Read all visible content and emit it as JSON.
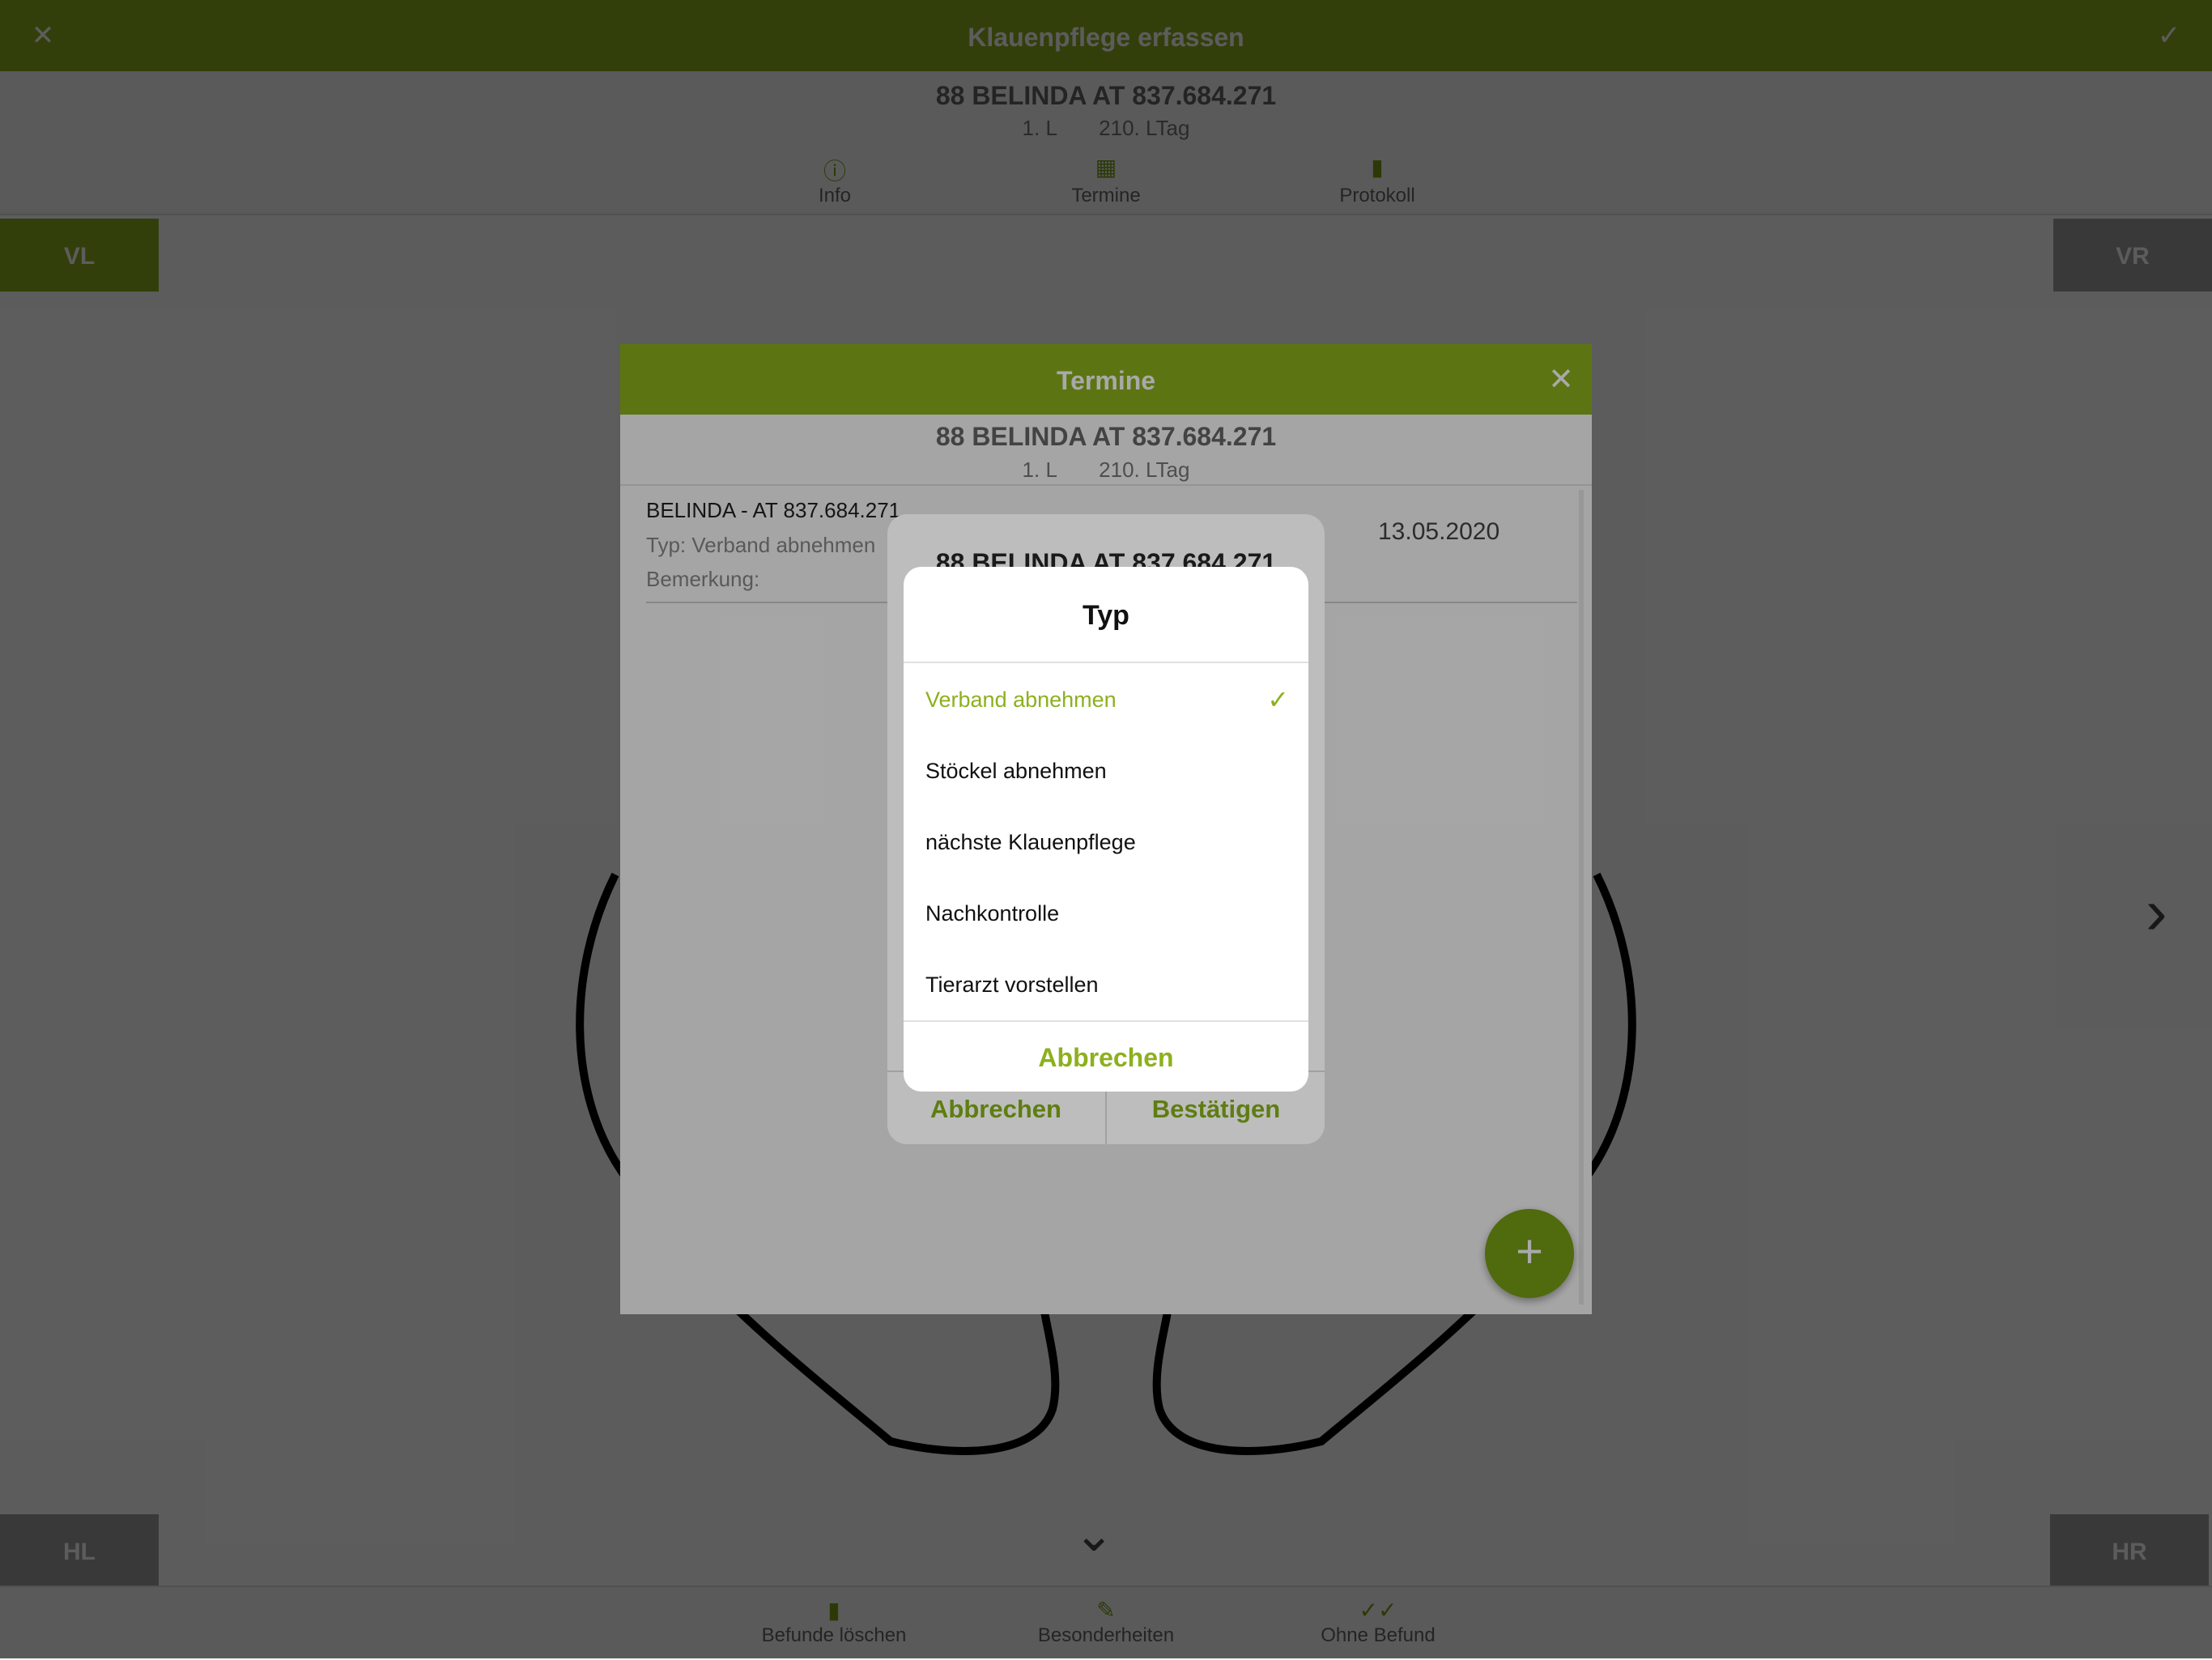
{
  "app": {
    "title": "Klauenpflege erfassen",
    "close_icon": "close-icon",
    "confirm_icon": "check-icon",
    "brand_color": "#8db01e"
  },
  "animal": {
    "name": "88 BELINDA AT 837.684.271",
    "lactation": "1. L",
    "lactation_day": "210. LTag"
  },
  "tabs": [
    {
      "label": "Info",
      "icon": "info-icon"
    },
    {
      "label": "Termine",
      "icon": "calendar-icon"
    },
    {
      "label": "Protokoll",
      "icon": "book-icon"
    }
  ],
  "legs": {
    "vl": "VL",
    "vr": "VR",
    "hl": "HL",
    "hr": "HR"
  },
  "bottom_actions": [
    {
      "label": "Befunde löschen",
      "icon": "trash-icon"
    },
    {
      "label": "Besonderheiten",
      "icon": "edit-icon"
    },
    {
      "label": "Ohne Befund",
      "icon": "double-check-icon"
    }
  ],
  "termine_dialog": {
    "title": "Termine",
    "animal_name": "88 BELINDA AT 837.684.271",
    "lactation": "1. L",
    "lactation_day": "210. LTag",
    "appointment": {
      "line1": "BELINDA - AT 837.684.271",
      "type": "Typ: Verband abnehmen",
      "remark": "Bemerkung:",
      "date": "13.05.2020"
    },
    "fab_label": "+"
  },
  "alert": {
    "animal_name": "88 BELINDA AT 837.684.271",
    "cancel_label": "Abbrechen",
    "confirm_label": "Bestätigen"
  },
  "type_picker": {
    "title": "Typ",
    "options": [
      {
        "label": "Verband abnehmen",
        "selected": true
      },
      {
        "label": "Stöckel abnehmen",
        "selected": false
      },
      {
        "label": "nächste Klauenpflege",
        "selected": false
      },
      {
        "label": "Nachkontrolle",
        "selected": false
      },
      {
        "label": "Tierarzt vorstellen",
        "selected": false
      }
    ],
    "cancel_label": "Abbrechen"
  }
}
